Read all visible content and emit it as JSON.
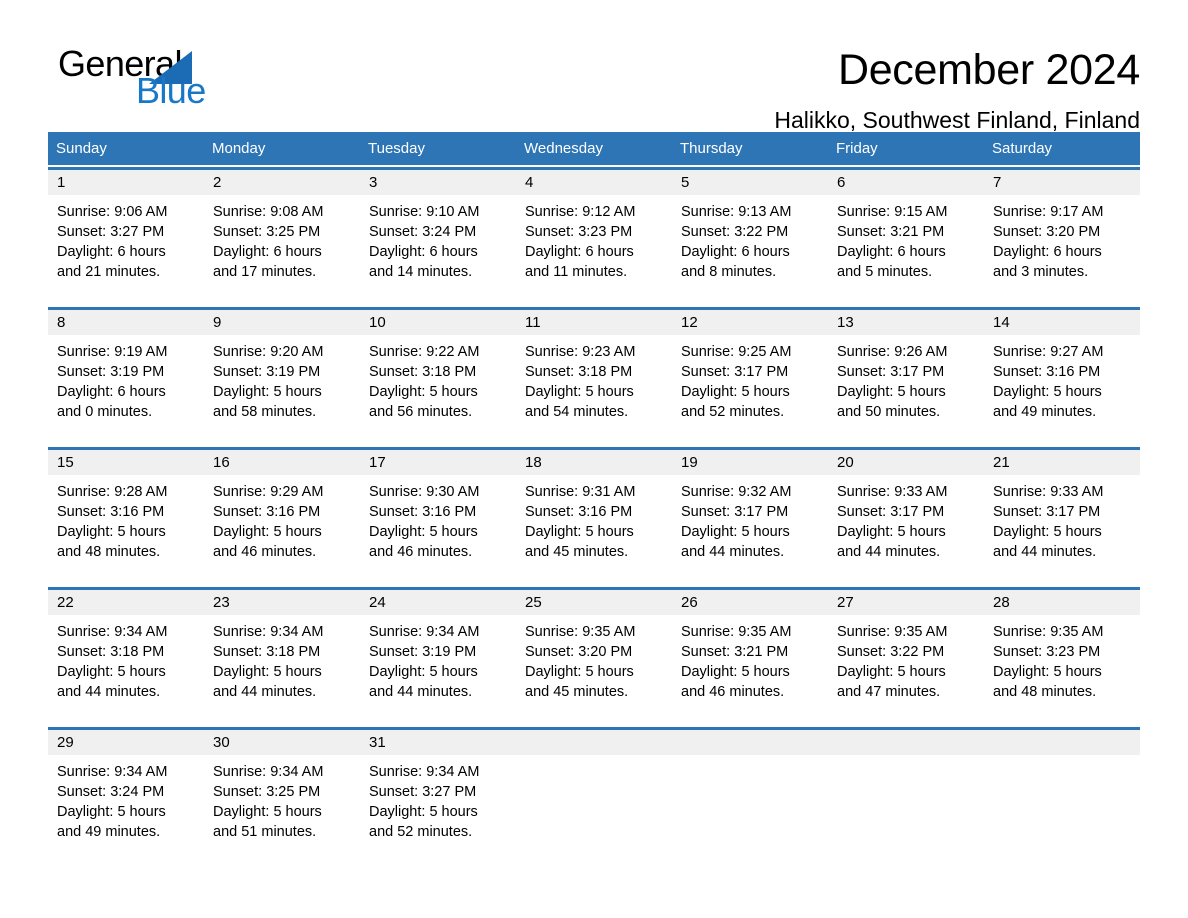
{
  "brand": {
    "name_part1": "General",
    "name_part2": "Blue",
    "mark": "triangle-mark",
    "colors": {
      "text_dark": "#000000",
      "blue": "#1878c8",
      "mark_blue": "#1c6cb5"
    }
  },
  "header": {
    "title": "December 2024",
    "subtitle": "Halikko, Southwest Finland, Finland"
  },
  "theme": {
    "header_blue": "#2e75b6",
    "daynum_band": "#f0f0f0",
    "separator_blue": "#2e75b6"
  },
  "weekdays": [
    "Sunday",
    "Monday",
    "Tuesday",
    "Wednesday",
    "Thursday",
    "Friday",
    "Saturday"
  ],
  "weeks": [
    {
      "days": [
        {
          "num": "1",
          "sunrise": "Sunrise: 9:06 AM",
          "sunset": "Sunset: 3:27 PM",
          "daylight1": "Daylight: 6 hours",
          "daylight2": "and 21 minutes."
        },
        {
          "num": "2",
          "sunrise": "Sunrise: 9:08 AM",
          "sunset": "Sunset: 3:25 PM",
          "daylight1": "Daylight: 6 hours",
          "daylight2": "and 17 minutes."
        },
        {
          "num": "3",
          "sunrise": "Sunrise: 9:10 AM",
          "sunset": "Sunset: 3:24 PM",
          "daylight1": "Daylight: 6 hours",
          "daylight2": "and 14 minutes."
        },
        {
          "num": "4",
          "sunrise": "Sunrise: 9:12 AM",
          "sunset": "Sunset: 3:23 PM",
          "daylight1": "Daylight: 6 hours",
          "daylight2": "and 11 minutes."
        },
        {
          "num": "5",
          "sunrise": "Sunrise: 9:13 AM",
          "sunset": "Sunset: 3:22 PM",
          "daylight1": "Daylight: 6 hours",
          "daylight2": "and 8 minutes."
        },
        {
          "num": "6",
          "sunrise": "Sunrise: 9:15 AM",
          "sunset": "Sunset: 3:21 PM",
          "daylight1": "Daylight: 6 hours",
          "daylight2": "and 5 minutes."
        },
        {
          "num": "7",
          "sunrise": "Sunrise: 9:17 AM",
          "sunset": "Sunset: 3:20 PM",
          "daylight1": "Daylight: 6 hours",
          "daylight2": "and 3 minutes."
        }
      ]
    },
    {
      "days": [
        {
          "num": "8",
          "sunrise": "Sunrise: 9:19 AM",
          "sunset": "Sunset: 3:19 PM",
          "daylight1": "Daylight: 6 hours",
          "daylight2": "and 0 minutes."
        },
        {
          "num": "9",
          "sunrise": "Sunrise: 9:20 AM",
          "sunset": "Sunset: 3:19 PM",
          "daylight1": "Daylight: 5 hours",
          "daylight2": "and 58 minutes."
        },
        {
          "num": "10",
          "sunrise": "Sunrise: 9:22 AM",
          "sunset": "Sunset: 3:18 PM",
          "daylight1": "Daylight: 5 hours",
          "daylight2": "and 56 minutes."
        },
        {
          "num": "11",
          "sunrise": "Sunrise: 9:23 AM",
          "sunset": "Sunset: 3:18 PM",
          "daylight1": "Daylight: 5 hours",
          "daylight2": "and 54 minutes."
        },
        {
          "num": "12",
          "sunrise": "Sunrise: 9:25 AM",
          "sunset": "Sunset: 3:17 PM",
          "daylight1": "Daylight: 5 hours",
          "daylight2": "and 52 minutes."
        },
        {
          "num": "13",
          "sunrise": "Sunrise: 9:26 AM",
          "sunset": "Sunset: 3:17 PM",
          "daylight1": "Daylight: 5 hours",
          "daylight2": "and 50 minutes."
        },
        {
          "num": "14",
          "sunrise": "Sunrise: 9:27 AM",
          "sunset": "Sunset: 3:16 PM",
          "daylight1": "Daylight: 5 hours",
          "daylight2": "and 49 minutes."
        }
      ]
    },
    {
      "days": [
        {
          "num": "15",
          "sunrise": "Sunrise: 9:28 AM",
          "sunset": "Sunset: 3:16 PM",
          "daylight1": "Daylight: 5 hours",
          "daylight2": "and 48 minutes."
        },
        {
          "num": "16",
          "sunrise": "Sunrise: 9:29 AM",
          "sunset": "Sunset: 3:16 PM",
          "daylight1": "Daylight: 5 hours",
          "daylight2": "and 46 minutes."
        },
        {
          "num": "17",
          "sunrise": "Sunrise: 9:30 AM",
          "sunset": "Sunset: 3:16 PM",
          "daylight1": "Daylight: 5 hours",
          "daylight2": "and 46 minutes."
        },
        {
          "num": "18",
          "sunrise": "Sunrise: 9:31 AM",
          "sunset": "Sunset: 3:16 PM",
          "daylight1": "Daylight: 5 hours",
          "daylight2": "and 45 minutes."
        },
        {
          "num": "19",
          "sunrise": "Sunrise: 9:32 AM",
          "sunset": "Sunset: 3:17 PM",
          "daylight1": "Daylight: 5 hours",
          "daylight2": "and 44 minutes."
        },
        {
          "num": "20",
          "sunrise": "Sunrise: 9:33 AM",
          "sunset": "Sunset: 3:17 PM",
          "daylight1": "Daylight: 5 hours",
          "daylight2": "and 44 minutes."
        },
        {
          "num": "21",
          "sunrise": "Sunrise: 9:33 AM",
          "sunset": "Sunset: 3:17 PM",
          "daylight1": "Daylight: 5 hours",
          "daylight2": "and 44 minutes."
        }
      ]
    },
    {
      "days": [
        {
          "num": "22",
          "sunrise": "Sunrise: 9:34 AM",
          "sunset": "Sunset: 3:18 PM",
          "daylight1": "Daylight: 5 hours",
          "daylight2": "and 44 minutes."
        },
        {
          "num": "23",
          "sunrise": "Sunrise: 9:34 AM",
          "sunset": "Sunset: 3:18 PM",
          "daylight1": "Daylight: 5 hours",
          "daylight2": "and 44 minutes."
        },
        {
          "num": "24",
          "sunrise": "Sunrise: 9:34 AM",
          "sunset": "Sunset: 3:19 PM",
          "daylight1": "Daylight: 5 hours",
          "daylight2": "and 44 minutes."
        },
        {
          "num": "25",
          "sunrise": "Sunrise: 9:35 AM",
          "sunset": "Sunset: 3:20 PM",
          "daylight1": "Daylight: 5 hours",
          "daylight2": "and 45 minutes."
        },
        {
          "num": "26",
          "sunrise": "Sunrise: 9:35 AM",
          "sunset": "Sunset: 3:21 PM",
          "daylight1": "Daylight: 5 hours",
          "daylight2": "and 46 minutes."
        },
        {
          "num": "27",
          "sunrise": "Sunrise: 9:35 AM",
          "sunset": "Sunset: 3:22 PM",
          "daylight1": "Daylight: 5 hours",
          "daylight2": "and 47 minutes."
        },
        {
          "num": "28",
          "sunrise": "Sunrise: 9:35 AM",
          "sunset": "Sunset: 3:23 PM",
          "daylight1": "Daylight: 5 hours",
          "daylight2": "and 48 minutes."
        }
      ]
    },
    {
      "days": [
        {
          "num": "29",
          "sunrise": "Sunrise: 9:34 AM",
          "sunset": "Sunset: 3:24 PM",
          "daylight1": "Daylight: 5 hours",
          "daylight2": "and 49 minutes."
        },
        {
          "num": "30",
          "sunrise": "Sunrise: 9:34 AM",
          "sunset": "Sunset: 3:25 PM",
          "daylight1": "Daylight: 5 hours",
          "daylight2": "and 51 minutes."
        },
        {
          "num": "31",
          "sunrise": "Sunrise: 9:34 AM",
          "sunset": "Sunset: 3:27 PM",
          "daylight1": "Daylight: 5 hours",
          "daylight2": "and 52 minutes."
        },
        {
          "num": "",
          "sunrise": "",
          "sunset": "",
          "daylight1": "",
          "daylight2": ""
        },
        {
          "num": "",
          "sunrise": "",
          "sunset": "",
          "daylight1": "",
          "daylight2": ""
        },
        {
          "num": "",
          "sunrise": "",
          "sunset": "",
          "daylight1": "",
          "daylight2": ""
        },
        {
          "num": "",
          "sunrise": "",
          "sunset": "",
          "daylight1": "",
          "daylight2": ""
        }
      ]
    }
  ]
}
